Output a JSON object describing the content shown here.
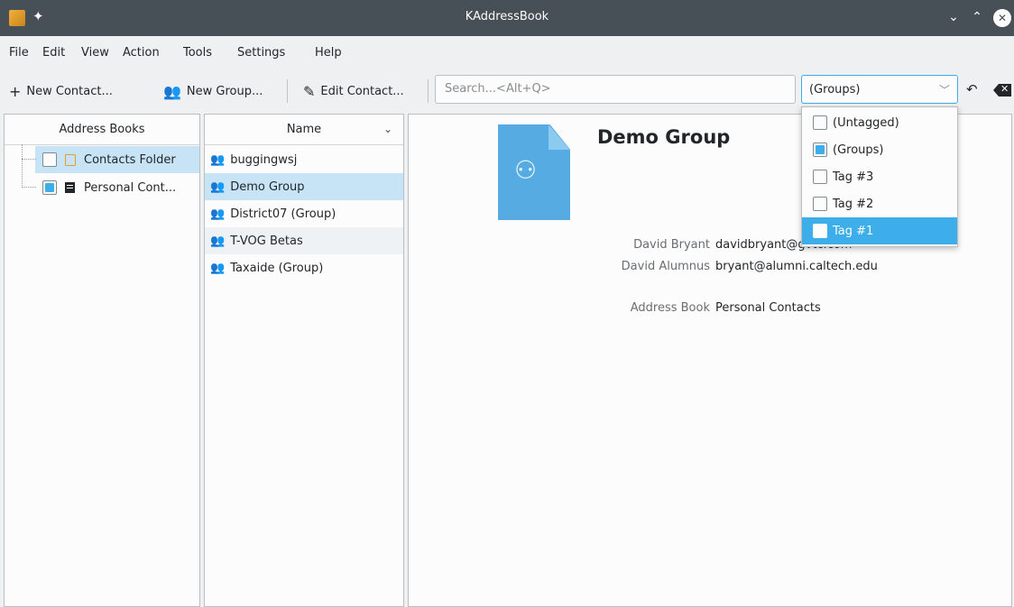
{
  "window": {
    "title": "KAddressBook"
  },
  "menu": [
    "File",
    "Edit",
    "View",
    "Action",
    "Tools",
    "Settings",
    "Help"
  ],
  "toolbar": {
    "new_contact": "New Contact...",
    "new_group": "New Group...",
    "edit_contact": "Edit Contact...",
    "search_placeholder": "Search...<Alt+Q>",
    "filter_value": "(Groups)"
  },
  "address_books": {
    "header": "Address Books",
    "items": [
      {
        "label": "Contacts Folder",
        "checked": false,
        "icon": "folder-icon"
      },
      {
        "label": "Personal Cont...",
        "checked": true,
        "icon": "addressbook-icon"
      }
    ]
  },
  "contact_list": {
    "header": "Name",
    "items": [
      {
        "label": "buggingwsj"
      },
      {
        "label": "Demo Group"
      },
      {
        "label": "District07 (Group)"
      },
      {
        "label": "T-VOG Betas"
      },
      {
        "label": "Taxaide (Group)"
      }
    ]
  },
  "detail": {
    "title": "Demo Group",
    "members": [
      {
        "name": "David Bryant",
        "email": "davidbryant@gvtc.com"
      },
      {
        "name": "David Alumnus",
        "email": "bryant@alumni.caltech.edu"
      }
    ],
    "address_book_label": "Address Book",
    "address_book_value": "Personal Contacts"
  },
  "filter_popup": {
    "items": [
      {
        "label": "(Untagged)",
        "checked": false
      },
      {
        "label": "(Groups)",
        "checked": true
      },
      {
        "label": "Tag #3",
        "checked": false
      },
      {
        "label": "Tag #2",
        "checked": false
      },
      {
        "label": "Tag #1",
        "checked": false
      }
    ]
  },
  "colors": {
    "accent": "#3daee9",
    "titlebar": "#475057",
    "selection": "#c7e4f7"
  }
}
